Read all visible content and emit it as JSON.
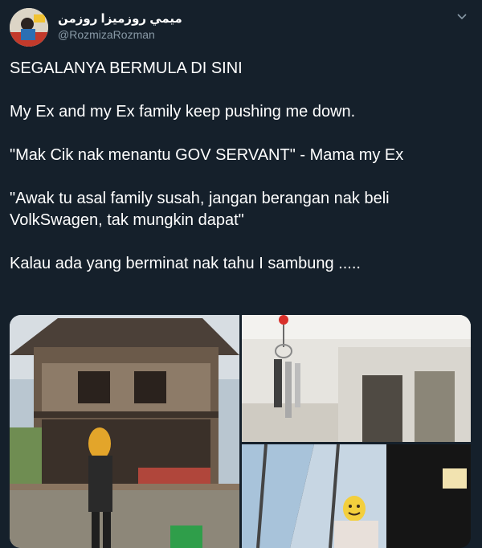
{
  "author": {
    "display_name": "ميمي روزميزا روزمن",
    "handle": "@RozmizaRozman"
  },
  "icons": {
    "avatar": "avatar-icon",
    "menu": "chevron-down-icon"
  },
  "tweet": {
    "lines": [
      "SEGALANYA BERMULA DI SINI",
      "My Ex and my Ex family keep pushing me down.",
      "\"Mak Cik nak menantu GOV SERVANT\" - Mama my Ex",
      "\"Awak tu asal family susah, jangan berangan nak beli VolkSwagen, tak mungkin dapat\"",
      "Kalau ada yang berminat nak tahu I sambung ....."
    ]
  },
  "media": {
    "count": 3,
    "items": [
      "old-wooden-house-photo",
      "house-keys-photo",
      "selfie-in-new-house-photo"
    ]
  },
  "colors": {
    "background": "#15202b",
    "text": "#ffffff",
    "secondary_text": "#8899a6"
  }
}
